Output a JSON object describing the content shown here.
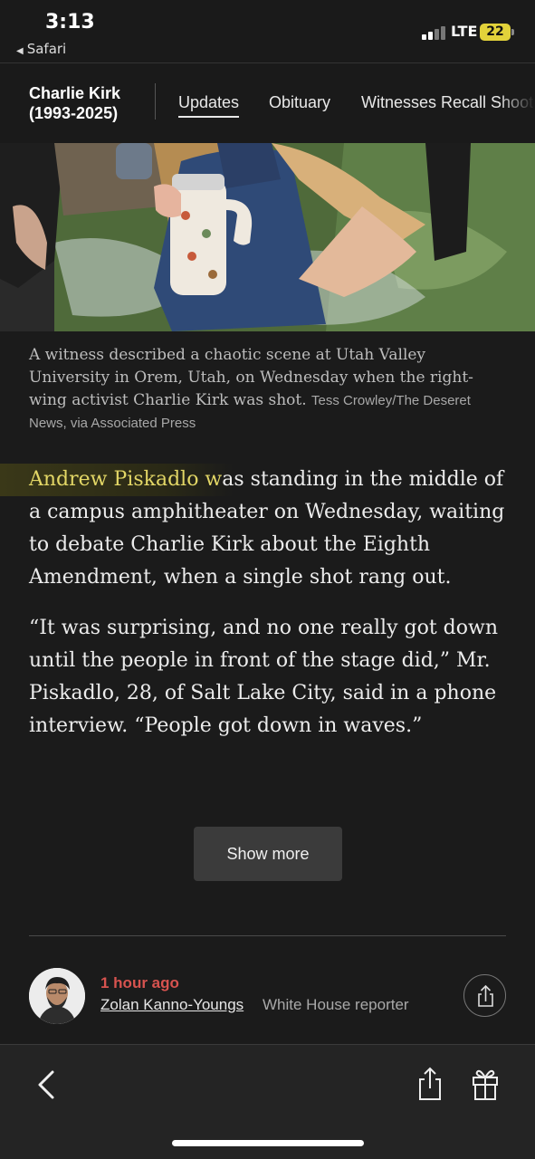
{
  "status_bar": {
    "time": "3:13",
    "back_app": "Safari",
    "network": "LTE",
    "battery": "22",
    "battery_color": "#e2d23a"
  },
  "nav": {
    "brand_line1": "Charlie Kirk",
    "brand_line2": "(1993-2025)",
    "tabs": [
      {
        "label": "Updates",
        "active": true
      },
      {
        "label": "Obituary",
        "active": false
      },
      {
        "label": "Witnesses Recall Shoot",
        "active": false
      }
    ]
  },
  "photo": {
    "caption": "A witness described a chaotic scene at Utah Valley University in Orem, Utah, on Wednesday when the right-wing activist Charlie Kirk was shot.",
    "credit": "Tess Crowley/The Deseret News, via Associated Press"
  },
  "article": {
    "para1_highlight": "Andrew Piskadlo w",
    "para1_rest": "as standing in the middle of a campus amphitheater on Wednesday, waiting to debate Charlie Kirk about the Eighth Amendment, when a single shot rang out.",
    "para2": "“It was surprising, and no one really got down until the people in front of the stage did,” Mr. Piskadlo, 28, of Salt Lake City, said in a phone interview. “People got down in waves.”",
    "highlight_color": "#e3d766"
  },
  "show_more_label": "Show more",
  "byline": {
    "time_ago": "1 hour ago",
    "author": "Zolan Kanno-Youngs",
    "role": "White House reporter",
    "time_color": "#d7534f"
  },
  "toolbar": {
    "icons": [
      "back-icon",
      "share-icon",
      "gift-icon"
    ]
  }
}
